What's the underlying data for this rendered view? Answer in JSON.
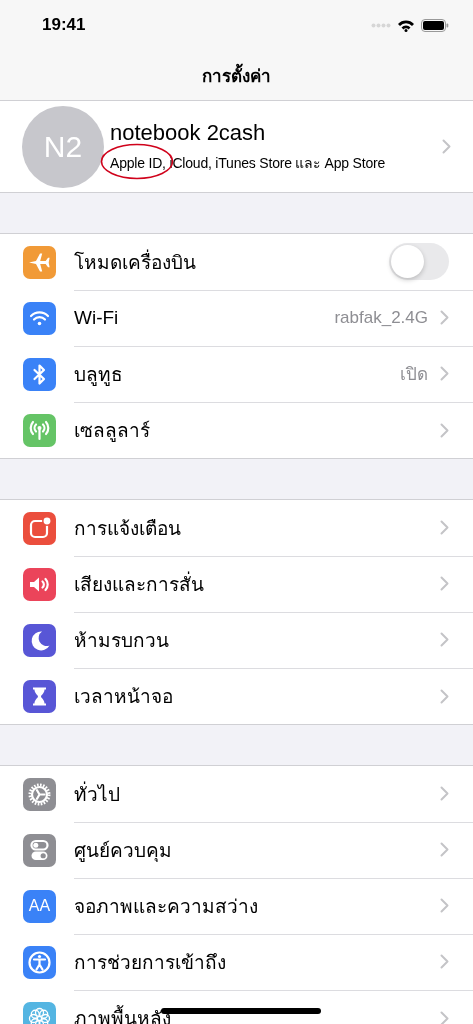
{
  "status_bar": {
    "time": "19:41"
  },
  "nav": {
    "title": "การตั้งค่า"
  },
  "profile": {
    "initials": "N2",
    "name": "notebook 2cash",
    "subtitle": "Apple ID, iCloud, iTunes Store และ App Store",
    "circled": true
  },
  "groups": [
    {
      "rows": [
        {
          "label": "โหมดเครื่องบิน",
          "kind": "toggle",
          "on": false,
          "color": "#f19a37"
        },
        {
          "label": "Wi-Fi",
          "kind": "link",
          "value": "rabfak_2.4G",
          "color": "#3a82f7"
        },
        {
          "label": "บลูทูธ",
          "kind": "link",
          "value": "เปิด",
          "color": "#3a82f7"
        },
        {
          "label": "เซลลูลาร์",
          "kind": "link",
          "color": "#65c466"
        }
      ]
    },
    {
      "rows": [
        {
          "label": "การแจ้งเตือน",
          "kind": "link",
          "color": "#eb4e3d"
        },
        {
          "label": "เสียงและการสั่น",
          "kind": "link",
          "color": "#eb445a"
        },
        {
          "label": "ห้ามรบกวน",
          "kind": "link",
          "color": "#5856d6"
        },
        {
          "label": "เวลาหน้าจอ",
          "kind": "link",
          "color": "#5856d6"
        }
      ]
    },
    {
      "rows": [
        {
          "label": "ทั่วไป",
          "kind": "link",
          "color": "#8e8e93"
        },
        {
          "label": "ศูนย์ควบคุม",
          "kind": "link",
          "color": "#8e8e93"
        },
        {
          "label": "จอภาพและความสว่าง",
          "kind": "link",
          "color": "#3a82f7",
          "icon_text": "AA"
        },
        {
          "label": "การช่วยการเข้าถึง",
          "kind": "link",
          "color": "#3a82f7"
        },
        {
          "label": "ภาพพื้นหลัง",
          "kind": "link",
          "color": "#54b5e2"
        }
      ]
    }
  ]
}
